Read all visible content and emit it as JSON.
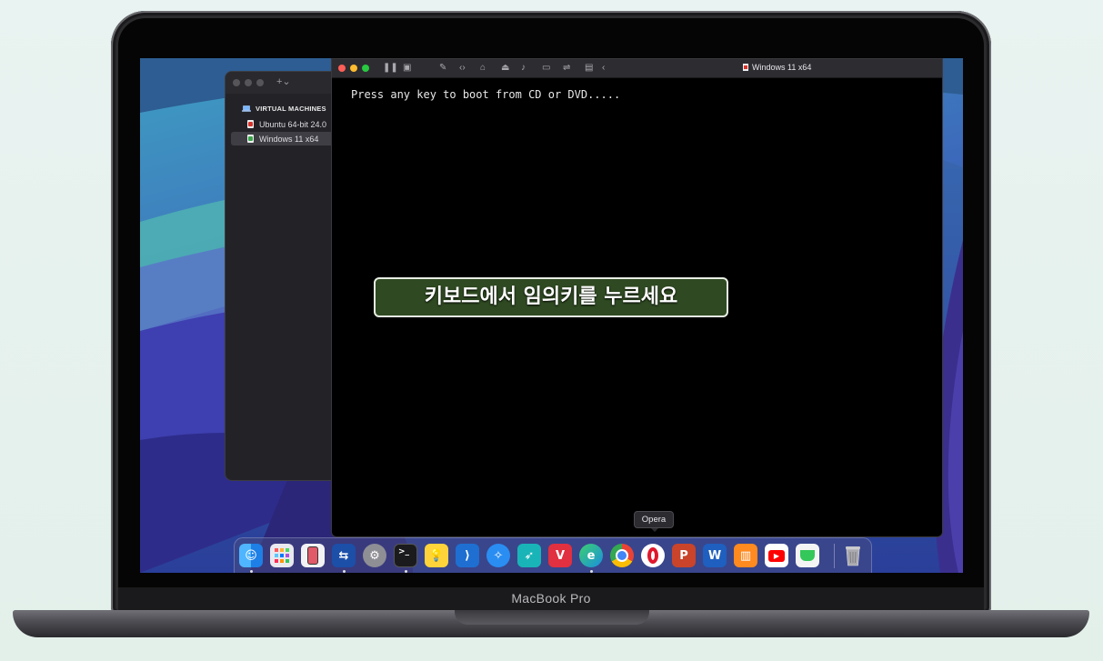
{
  "device_label": "MacBook Pro",
  "sidebar": {
    "add_button": "+⌄",
    "section_title": "VIRTUAL MACHINES",
    "items": [
      {
        "label": "Ubuntu 64-bit 24.0",
        "selected": false
      },
      {
        "label": "Windows 11 x64",
        "selected": true
      }
    ]
  },
  "vm_window": {
    "title": "Windows 11 x64",
    "console_text": "Press any key to boot from CD or DVD.....",
    "overlay_caption": "키보드에서 임의키를  누르세요"
  },
  "tooltip": "Opera",
  "colors": {
    "traffic_close": "#ff5f57",
    "traffic_minimize": "#febc2e",
    "traffic_zoom": "#28c840",
    "caption_bg": "#2f4a22"
  },
  "dock": {
    "apps": [
      {
        "name": "Finder",
        "icon": "finder-icon"
      },
      {
        "name": "Launchpad",
        "icon": "launchpad-icon"
      },
      {
        "name": "iPhone Mirroring",
        "icon": "iphone-icon"
      },
      {
        "name": "Remote Desktop",
        "icon": "remote-desktop-icon"
      },
      {
        "name": "System Settings",
        "icon": "settings-icon"
      },
      {
        "name": "Terminal",
        "icon": "terminal-icon"
      },
      {
        "name": "Tips",
        "icon": "lightbulb-icon"
      },
      {
        "name": "Visual Studio Code",
        "icon": "vscode-icon"
      },
      {
        "name": "Safari",
        "icon": "safari-icon"
      },
      {
        "name": "Swift Playgrounds",
        "icon": "swift-icon"
      },
      {
        "name": "Vivaldi",
        "icon": "vivaldi-icon"
      },
      {
        "name": "Microsoft Edge",
        "icon": "edge-icon"
      },
      {
        "name": "Google Chrome",
        "icon": "chrome-icon"
      },
      {
        "name": "Opera",
        "icon": "opera-icon"
      },
      {
        "name": "Microsoft PowerPoint",
        "icon": "powerpoint-icon"
      },
      {
        "name": "Microsoft Word",
        "icon": "word-icon"
      },
      {
        "name": "Books",
        "icon": "books-icon"
      },
      {
        "name": "YouTube",
        "icon": "youtube-icon"
      },
      {
        "name": "Coffee",
        "icon": "cup-icon"
      },
      {
        "name": "Trash",
        "icon": "trash-icon"
      }
    ]
  }
}
